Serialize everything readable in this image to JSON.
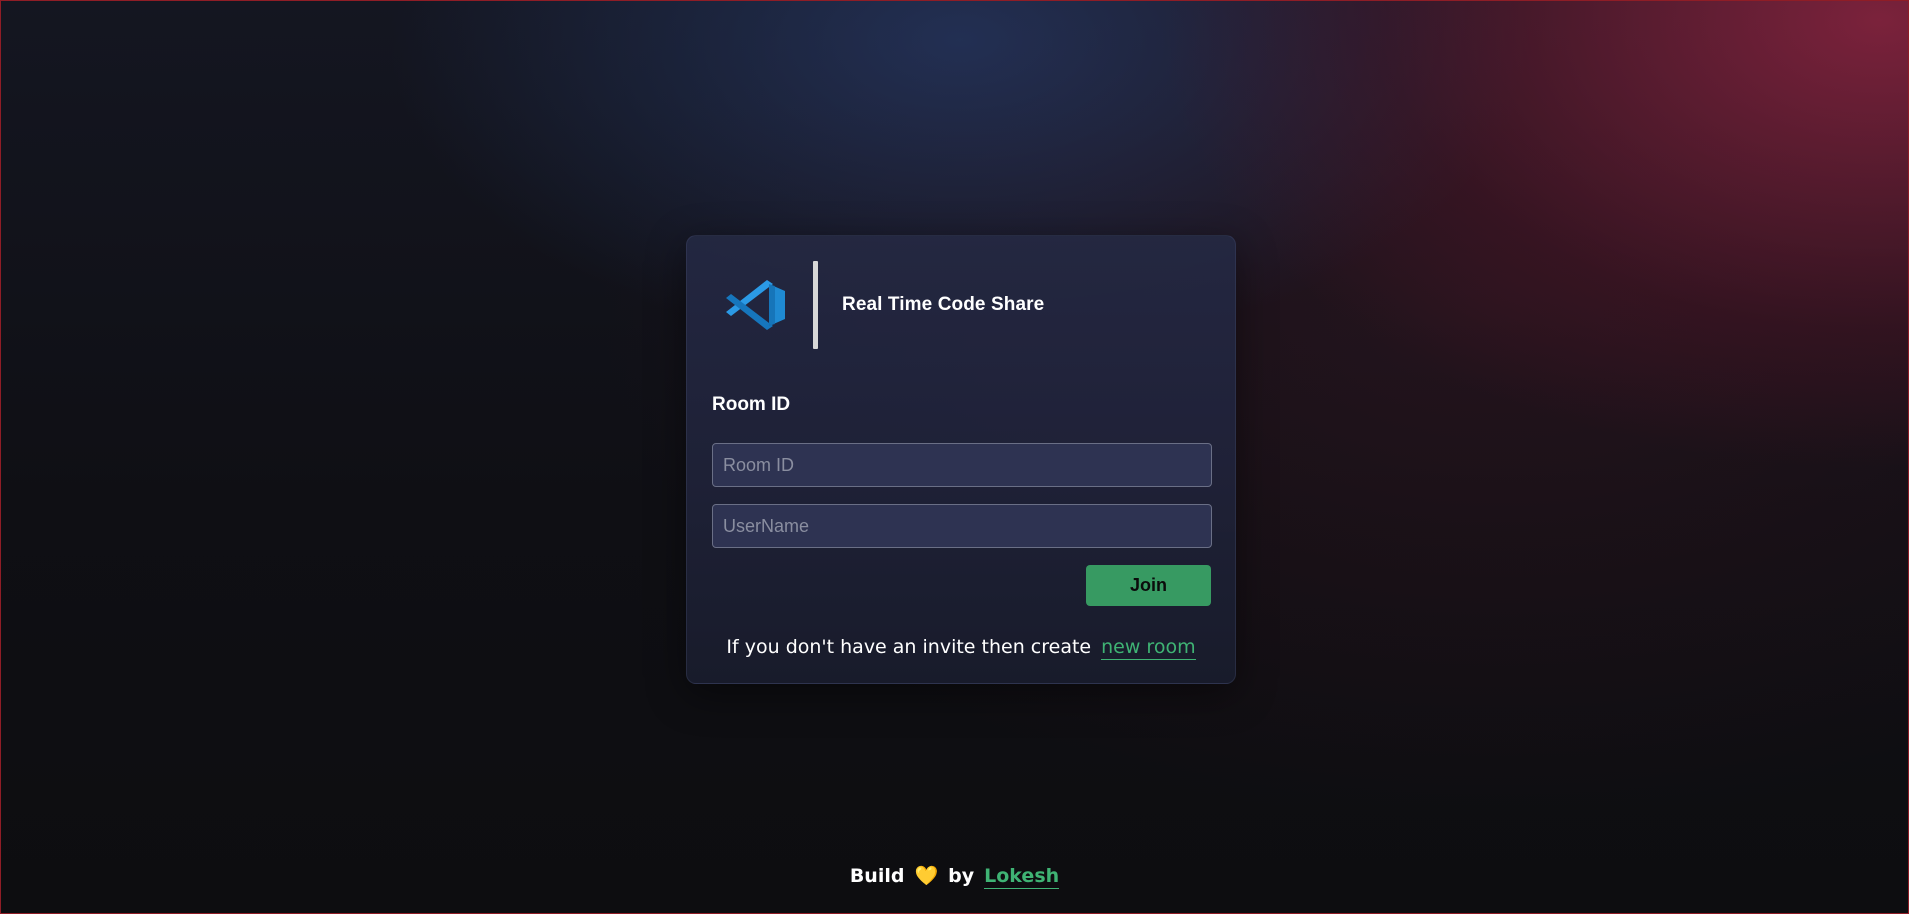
{
  "card": {
    "app_title": "Real Time Code Share",
    "logo_icon": "vscode-logo-icon",
    "room_label": "Room ID",
    "room_input": {
      "placeholder": "Room ID",
      "value": ""
    },
    "username_input": {
      "placeholder": "UserName",
      "value": ""
    },
    "join_label": "Join",
    "invite_text": "If you don't have an invite then create",
    "new_room_link": "new room"
  },
  "footer": {
    "build_text": "Build",
    "heart_icon": "yellow-heart-icon",
    "heart_glyph": "💛",
    "by_text": "by",
    "author_link": "Lokesh"
  },
  "colors": {
    "accent_green": "#379a62",
    "link_green": "#3fb374",
    "logo_blue": "#1f8ad2",
    "heart_yellow": "#f3c932",
    "card_bg": "#242842"
  }
}
